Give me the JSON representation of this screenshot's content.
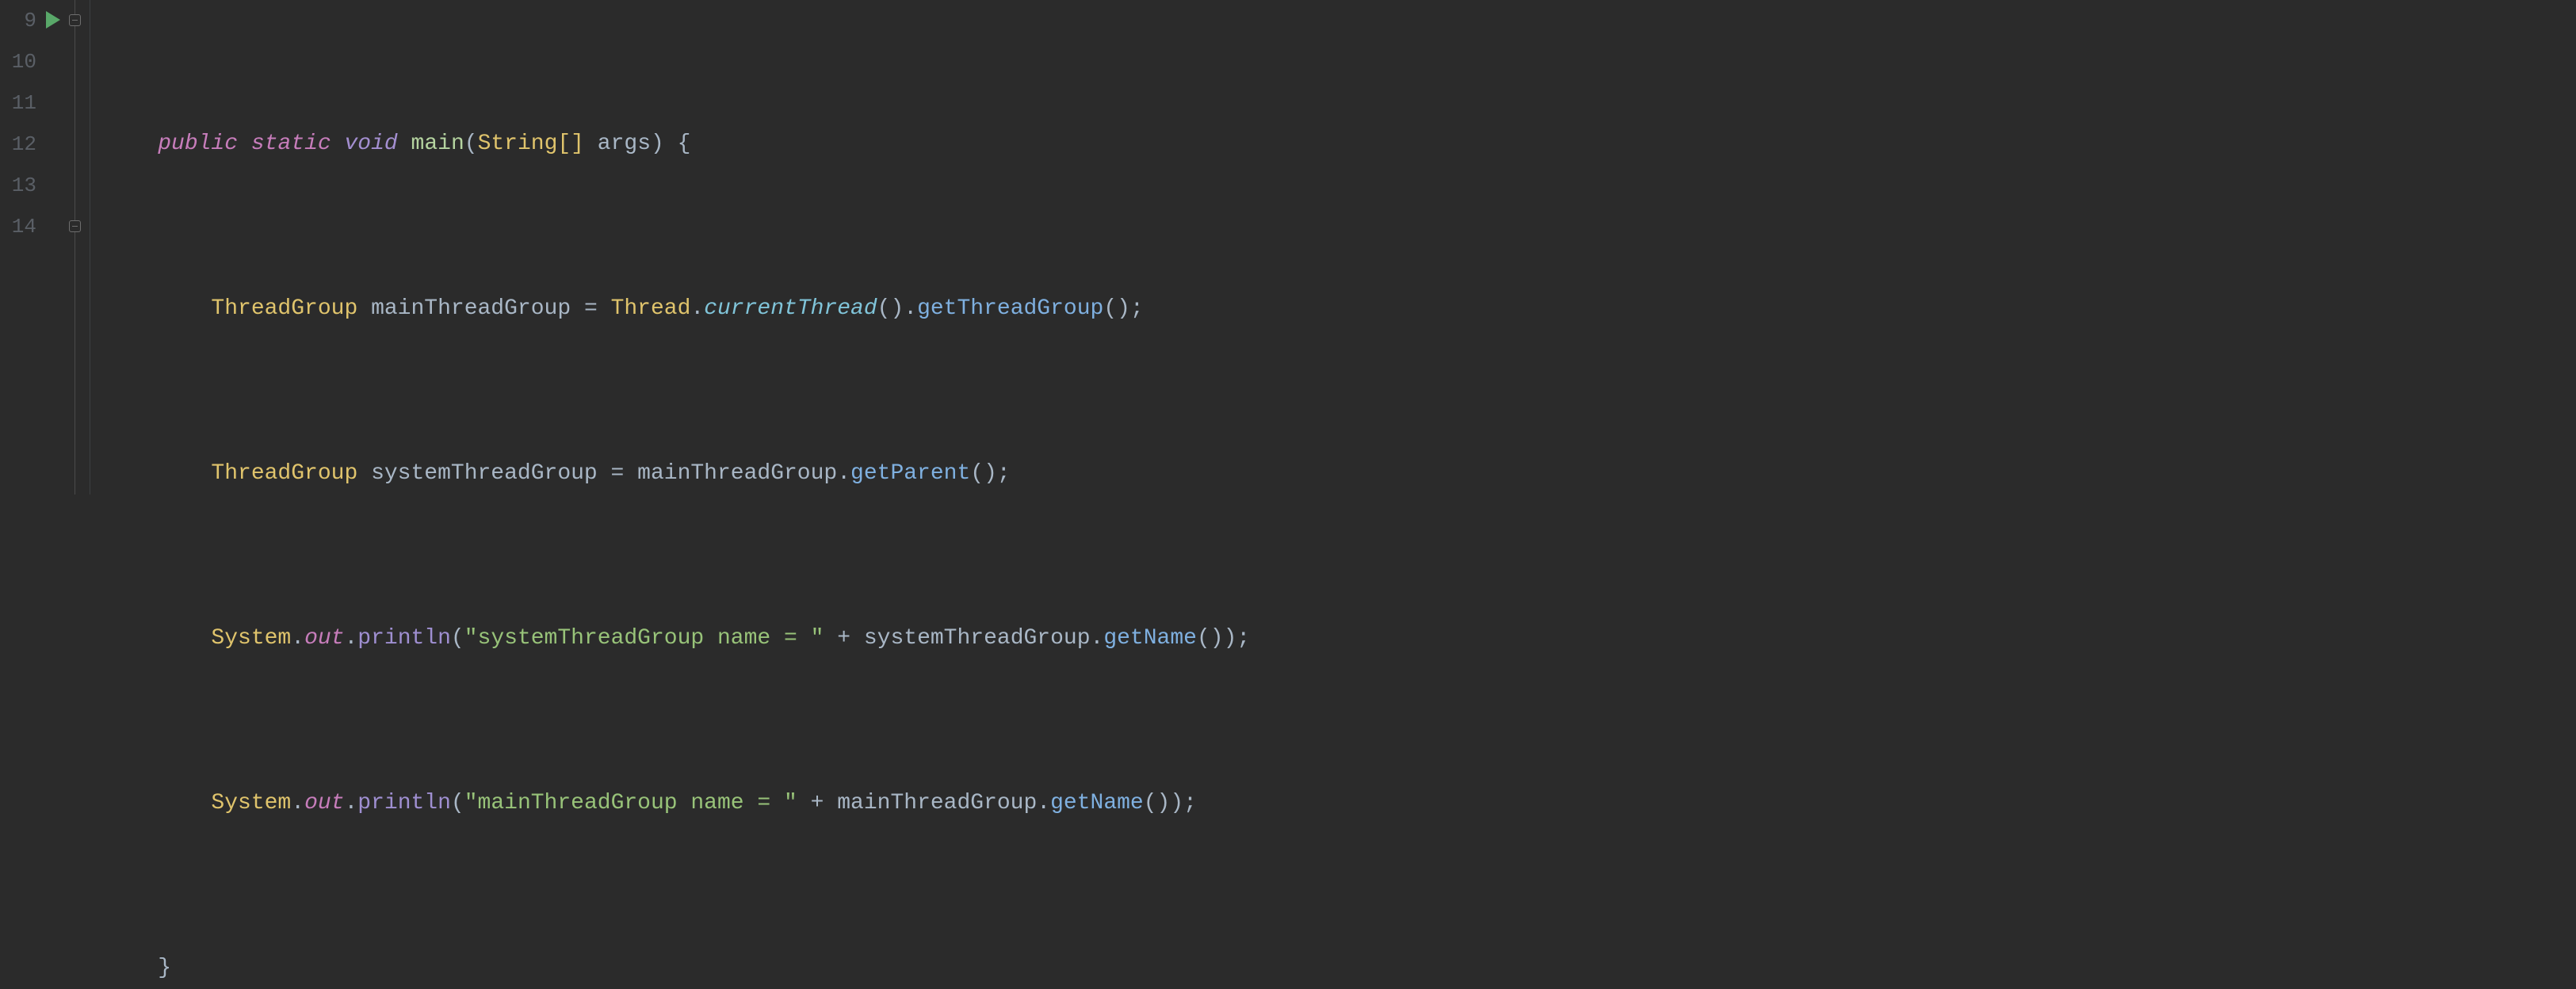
{
  "gutter": {
    "lines": [
      "9",
      "10",
      "11",
      "12",
      "13",
      "14"
    ]
  },
  "icons": {
    "run": "run-icon",
    "fold_open_top": "fold-open",
    "fold_open_bottom": "fold-close"
  },
  "code": {
    "line9": {
      "indent": "    ",
      "kw_public": "public",
      "kw_static": "static",
      "kw_void": "void",
      "fn_main": "main",
      "type_string_arr": "String[]",
      "param_args": "args",
      "brace_open": "{"
    },
    "line10": {
      "indent": "        ",
      "type_threadgroup": "ThreadGroup",
      "var_mainTG": "mainThreadGroup",
      "eq": "=",
      "type_thread": "Thread",
      "call_currentThread": "currentThread",
      "call_getThreadGroup": "getThreadGroup",
      "semi": ";"
    },
    "line11": {
      "indent": "        ",
      "type_threadgroup": "ThreadGroup",
      "var_systemTG": "systemThreadGroup",
      "eq": "=",
      "ref_mainTG": "mainThreadGroup",
      "call_getParent": "getParent",
      "semi": ";"
    },
    "line12": {
      "indent": "        ",
      "type_system": "System",
      "field_out": "out",
      "call_println": "println",
      "str": "\"systemThreadGroup name = \"",
      "plus": "+",
      "ref_systemTG": "systemThreadGroup",
      "call_getName": "getName",
      "semi": ";"
    },
    "line13": {
      "indent": "        ",
      "type_system": "System",
      "field_out": "out",
      "call_println": "println",
      "str": "\"mainThreadGroup name = \"",
      "plus": "+",
      "ref_mainTG": "mainThreadGroup",
      "call_getName": "getName",
      "semi": ";"
    },
    "line14": {
      "indent": "    ",
      "brace_close": "}"
    }
  }
}
